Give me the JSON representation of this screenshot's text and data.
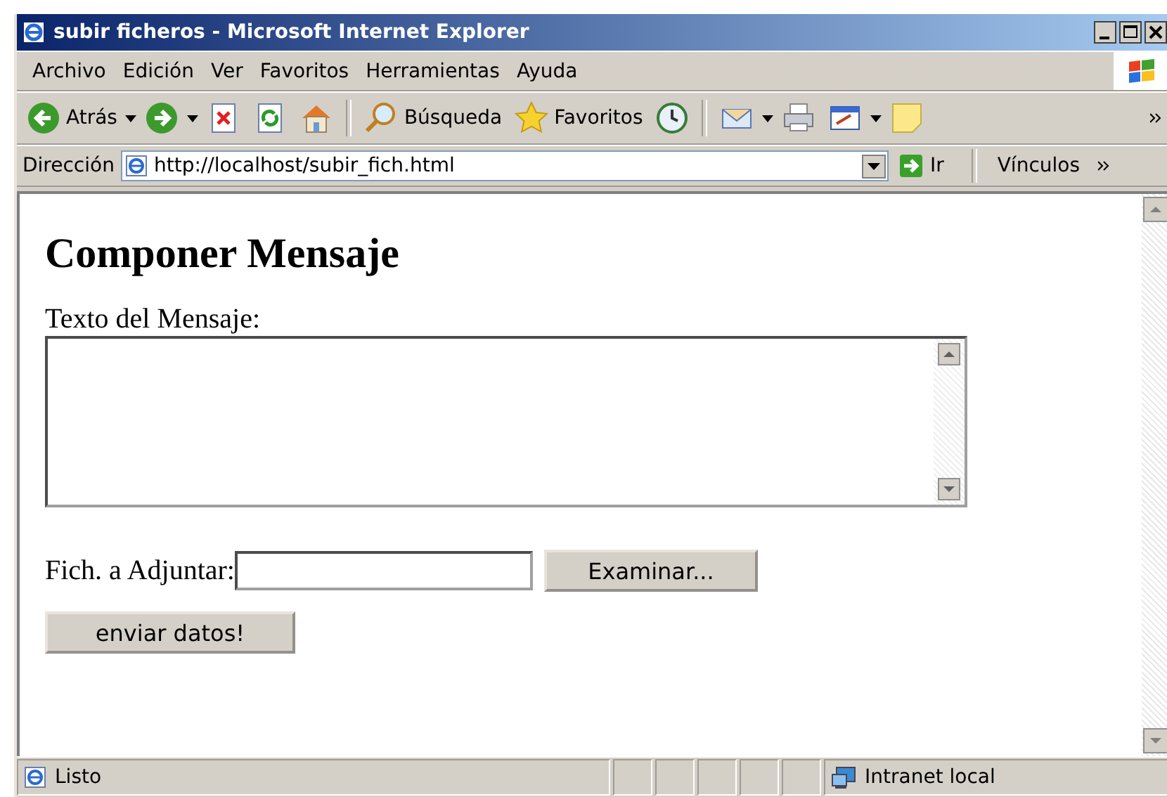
{
  "window": {
    "title": "subir ficheros - Microsoft Internet Explorer"
  },
  "menu": [
    "Archivo",
    "Edición",
    "Ver",
    "Favoritos",
    "Herramientas",
    "Ayuda"
  ],
  "toolbar": [
    {
      "kind": "back",
      "label": "Atrás",
      "dropdown": true
    },
    {
      "kind": "forward",
      "dropdown": true
    },
    {
      "kind": "stop"
    },
    {
      "kind": "refresh"
    },
    {
      "kind": "home"
    },
    {
      "kind": "separator"
    },
    {
      "kind": "search",
      "label": "Búsqueda"
    },
    {
      "kind": "favorites",
      "label": "Favoritos"
    },
    {
      "kind": "history"
    },
    {
      "kind": "separator"
    },
    {
      "kind": "mail",
      "dropdown": true
    },
    {
      "kind": "print"
    },
    {
      "kind": "edit",
      "dropdown": true
    },
    {
      "kind": "note"
    }
  ],
  "address": {
    "label": "Dirección",
    "url": "http://localhost/subir_fich.html",
    "go": "Ir",
    "links": "Vínculos"
  },
  "page": {
    "heading": "Componer Mensaje",
    "message_label": "Texto del Mensaje:",
    "file_label": "Fich. a Adjuntar:",
    "browse_button": "Examinar...",
    "submit_button": "enviar datos!"
  },
  "status_bar": {
    "text": "Listo",
    "zone": "Intranet local"
  }
}
